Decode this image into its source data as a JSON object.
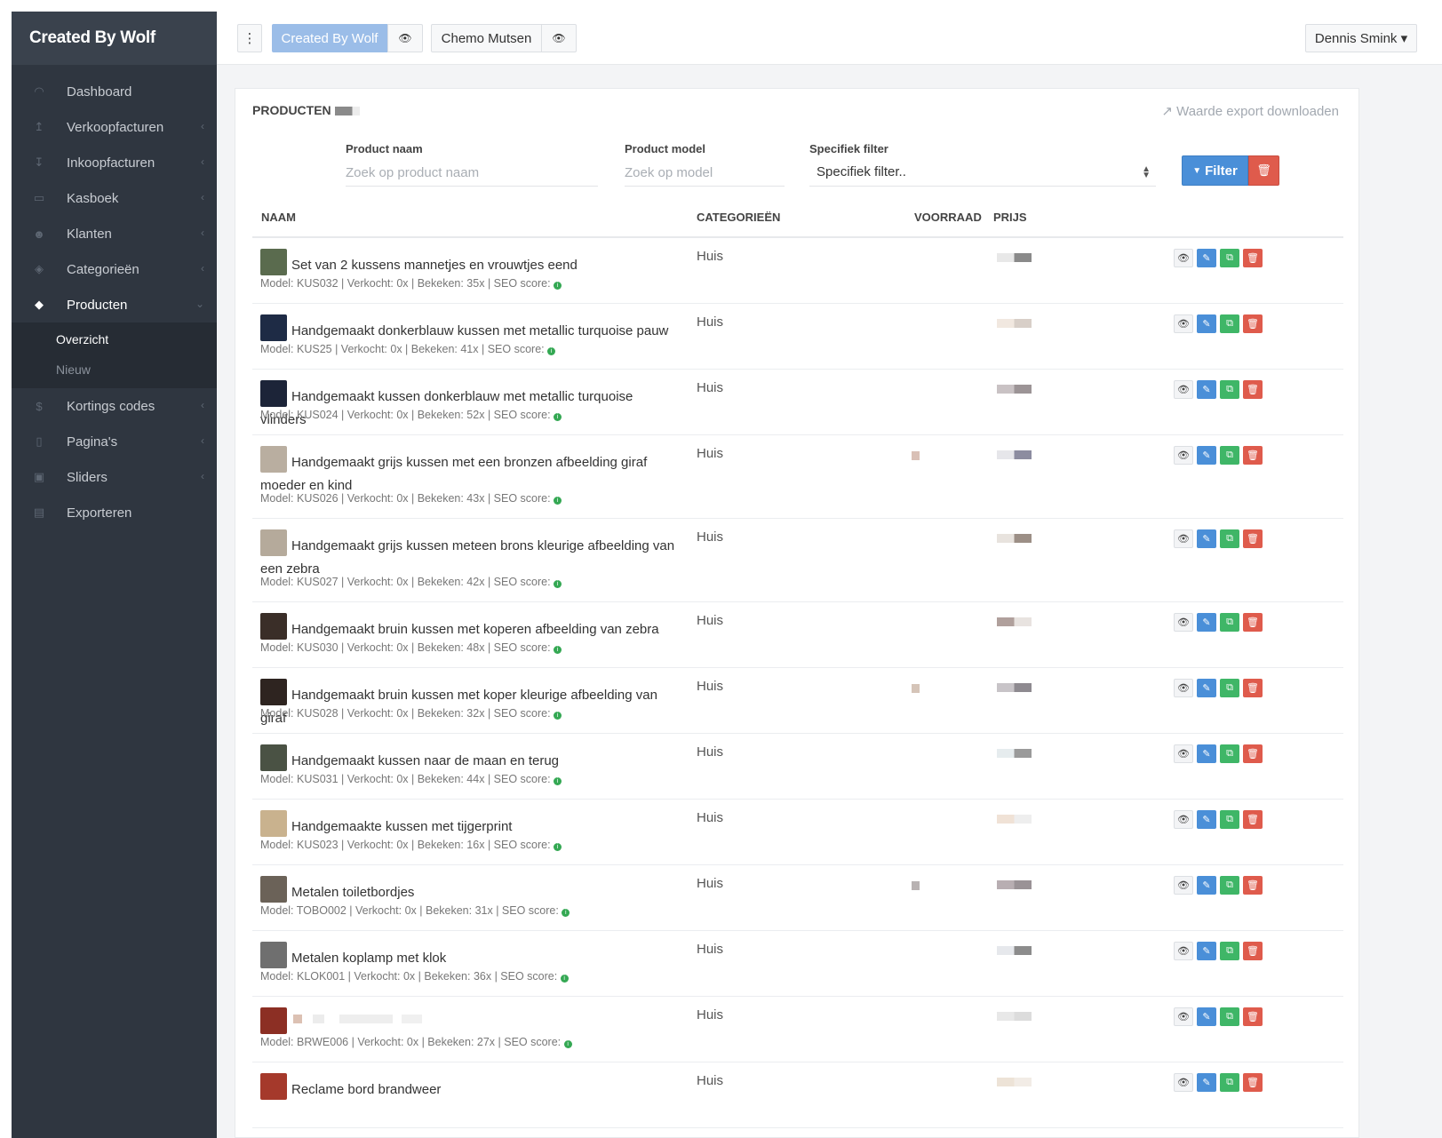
{
  "brand": "Created By Wolf",
  "topbar": {
    "menu_icon": "⋮",
    "eye_icon": "👁",
    "shop_active": "Created By Wolf",
    "shop_other": "Chemo Mutsen",
    "user": "Dennis Smink ▾"
  },
  "sidebar": {
    "items": [
      {
        "label": "Dashboard",
        "icon": "◠",
        "chev": ""
      },
      {
        "label": "Verkoopfacturen",
        "icon": "↥",
        "chev": "‹"
      },
      {
        "label": "Inkoopfacturen",
        "icon": "↧",
        "chev": "‹"
      },
      {
        "label": "Kasboek",
        "icon": "▭",
        "chev": "‹"
      },
      {
        "label": "Klanten",
        "icon": "☻",
        "chev": "‹"
      },
      {
        "label": "Categorieën",
        "icon": "◈",
        "chev": "‹"
      },
      {
        "label": "Producten",
        "icon": "◆",
        "chev": "⌄"
      },
      {
        "label": "Kortings codes",
        "icon": "$",
        "chev": "‹"
      },
      {
        "label": "Pagina's",
        "icon": "▯",
        "chev": "‹"
      },
      {
        "label": "Sliders",
        "icon": "▣",
        "chev": "‹"
      },
      {
        "label": "Exporteren",
        "icon": "▤",
        "chev": ""
      }
    ],
    "sub_items": [
      "Overzicht",
      "Nieuw"
    ]
  },
  "panel": {
    "title": "PRODUCTEN",
    "export": "Waarde export downloaden",
    "export_icon": "↗"
  },
  "filters": {
    "name_label": "Product naam",
    "name_placeholder": "Zoek op product naam",
    "model_label": "Product model",
    "model_placeholder": "Zoek op model",
    "special_label": "Specifiek filter",
    "special_value": "Specifiek filter..",
    "filter_button": "Filter",
    "filter_icon": "▼",
    "clear_icon": "🗑"
  },
  "table": {
    "headers": {
      "naam": "NAAM",
      "cat": "CATEGORIEËN",
      "voorraad": "VOORRAAD",
      "prijs": "PRIJS"
    },
    "rows": [
      {
        "name": "Set van 2 kussens mannetjes en vrouwtjes eend",
        "meta": "Model: KUS032 | Verkocht: 0x | Bekeken: 35x | SEO score:",
        "cat": "Huis"
      },
      {
        "name": "Handgemaakt donkerblauw kussen met metallic turquoise pauw",
        "meta": "Model: KUS25 | Verkocht: 0x | Bekeken: 41x | SEO score:",
        "cat": "Huis"
      },
      {
        "name": "Handgemaakt kussen donkerblauw met metallic turquoise vlinders",
        "meta": "Model: KUS024 | Verkocht: 0x | Bekeken: 52x | SEO score:",
        "cat": "Huis"
      },
      {
        "name": "Handgemaakt grijs kussen met een bronzen afbeelding giraf moeder en kind",
        "meta": "Model: KUS026 | Verkocht: 0x | Bekeken: 43x | SEO score:",
        "cat": "Huis"
      },
      {
        "name": "Handgemaakt grijs kussen meteen brons kleurige afbeelding van een zebra",
        "meta": "Model: KUS027 | Verkocht: 0x | Bekeken: 42x | SEO score:",
        "cat": "Huis"
      },
      {
        "name": "Handgemaakt bruin kussen met koperen afbeelding van zebra",
        "meta": "Model: KUS030 | Verkocht: 0x | Bekeken: 48x | SEO score:",
        "cat": "Huis"
      },
      {
        "name": "Handgemaakt bruin kussen met koper kleurige afbeelding van giraf",
        "meta": "Model: KUS028 | Verkocht: 0x | Bekeken: 32x | SEO score:",
        "cat": "Huis"
      },
      {
        "name": "Handgemaakt kussen naar de maan en terug",
        "meta": "Model: KUS031 | Verkocht: 0x | Bekeken: 44x | SEO score:",
        "cat": "Huis"
      },
      {
        "name": "Handgemaakte kussen met tijgerprint",
        "meta": "Model: KUS023 | Verkocht: 0x | Bekeken: 16x | SEO score:",
        "cat": "Huis"
      },
      {
        "name": "Metalen toiletbordjes",
        "meta": "Model: TOBO002 | Verkocht: 0x | Bekeken: 31x | SEO score:",
        "cat": "Huis"
      },
      {
        "name": "Metalen koplamp met klok",
        "meta": "Model: KLOK001 | Verkocht: 0x | Bekeken: 36x | SEO score:",
        "cat": "Huis"
      },
      {
        "name": "",
        "meta": "Model: BRWE006 | Verkocht: 0x | Bekeken: 27x | SEO score:",
        "cat": "Huis"
      },
      {
        "name": "Reclame bord brandweer",
        "meta": "",
        "cat": "Huis"
      }
    ],
    "action_icons": {
      "view": "👁",
      "edit": "✎",
      "copy": "⧉",
      "del": "🗑"
    },
    "seo_icon": "i"
  },
  "colors": {
    "sidebar": "#2f3640",
    "primary": "#4a8fd8",
    "success": "#3fb667",
    "danger": "#df5b4c",
    "shop_active": "#9bbde8"
  }
}
